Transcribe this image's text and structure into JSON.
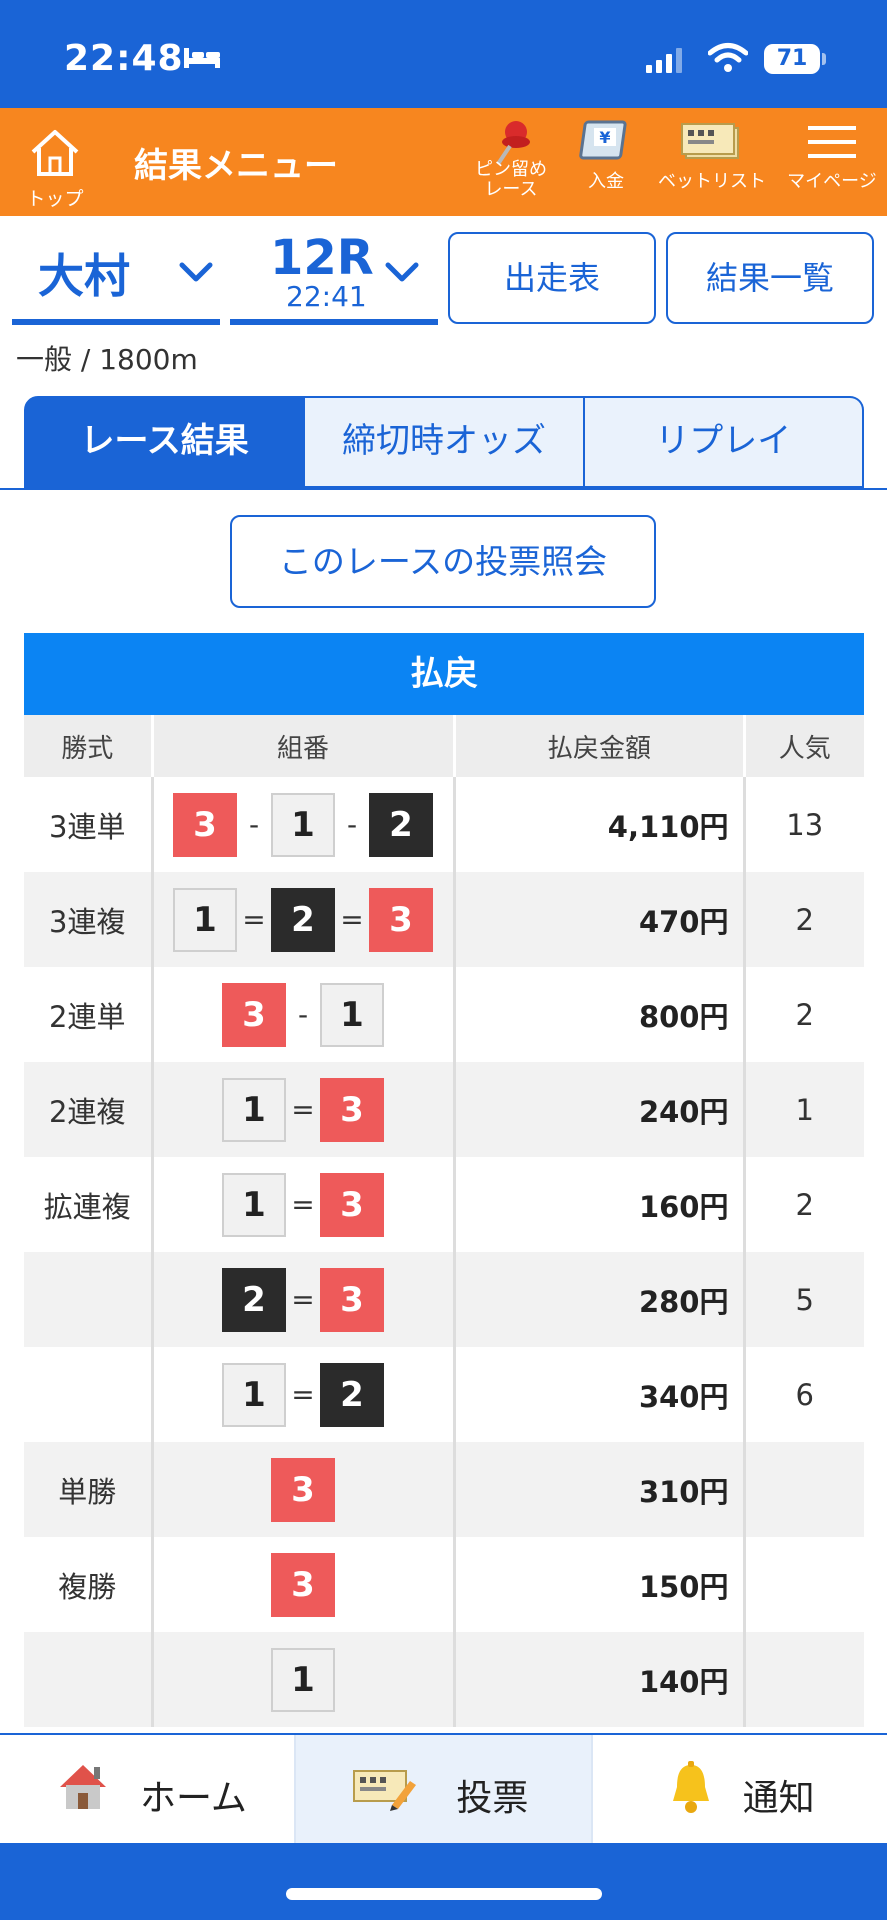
{
  "status_bar": {
    "time": "22:48",
    "battery": "71"
  },
  "top_nav": {
    "home_label": "トップ",
    "title": "結果メニュー",
    "items": [
      {
        "label": "ピン留め\nレース",
        "icon": "pin-icon"
      },
      {
        "label": "入金",
        "icon": "deposit-icon"
      },
      {
        "label": "ベットリスト",
        "icon": "bet-list-icon"
      },
      {
        "label": "マイページ",
        "icon": "hamburger-menu-icon"
      }
    ]
  },
  "race_selector": {
    "venue": "大村",
    "race": "12R",
    "race_time": "22:41",
    "entry_table_button": "出走表",
    "results_list_button": "結果一覧"
  },
  "race_info": "一般 / 1800m",
  "tabs": [
    {
      "label": "レース結果",
      "active": true
    },
    {
      "label": "締切時オッズ",
      "active": false
    },
    {
      "label": "リプレイ",
      "active": false
    }
  ],
  "inquiry_button": "このレースの投票照会",
  "payout": {
    "title": "払戻",
    "headers": [
      "勝式",
      "組番",
      "払戻金額",
      "人気"
    ],
    "rows": [
      {
        "type": "3連単",
        "boats": [
          "3",
          "1",
          "2"
        ],
        "sep": "-",
        "amount": "4,110円",
        "pop": "13"
      },
      {
        "type": "3連複",
        "boats": [
          "1",
          "2",
          "3"
        ],
        "sep": "=",
        "amount": "470円",
        "pop": "2"
      },
      {
        "type": "2連単",
        "boats": [
          "3",
          "1"
        ],
        "sep": "-",
        "amount": "800円",
        "pop": "2"
      },
      {
        "type": "2連複",
        "boats": [
          "1",
          "3"
        ],
        "sep": "=",
        "amount": "240円",
        "pop": "1"
      },
      {
        "type": "拡連複",
        "boats": [
          "1",
          "3"
        ],
        "sep": "=",
        "amount": "160円",
        "pop": "2"
      },
      {
        "type": "",
        "boats": [
          "2",
          "3"
        ],
        "sep": "=",
        "amount": "280円",
        "pop": "5"
      },
      {
        "type": "",
        "boats": [
          "1",
          "2"
        ],
        "sep": "=",
        "amount": "340円",
        "pop": "6"
      },
      {
        "type": "単勝",
        "boats": [
          "3"
        ],
        "sep": "",
        "amount": "310円",
        "pop": ""
      },
      {
        "type": "複勝",
        "boats": [
          "3"
        ],
        "sep": "",
        "amount": "150円",
        "pop": ""
      },
      {
        "type": "",
        "boats": [
          "1"
        ],
        "sep": "",
        "amount": "140円",
        "pop": ""
      }
    ]
  },
  "bottom_bar": [
    {
      "label": "ホーム",
      "icon": "house-icon",
      "active": false
    },
    {
      "label": "投票",
      "icon": "ticket-icon",
      "active": true
    },
    {
      "label": "通知",
      "icon": "bell-icon",
      "active": false
    }
  ],
  "colors": {
    "primary": "#1a64d6",
    "orange": "#f7861f",
    "boat3": "#ee5a5a",
    "boat2": "#2b2b2b"
  }
}
